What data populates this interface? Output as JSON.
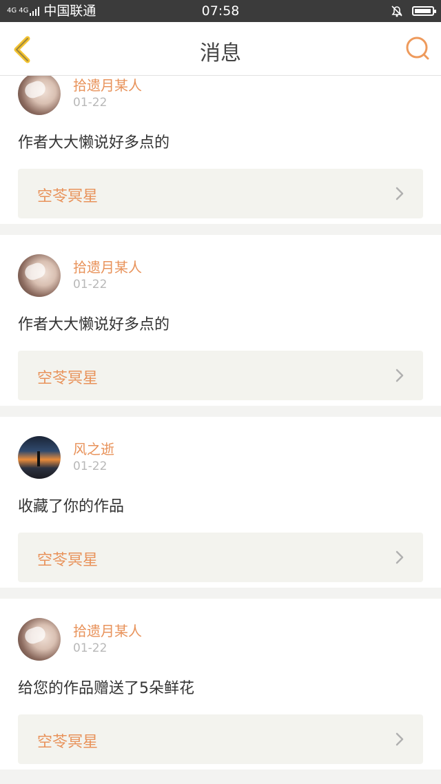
{
  "status_bar": {
    "network": "4G 4G",
    "carrier": "中国联通",
    "time": "07:58",
    "battery_level": 0.95
  },
  "nav": {
    "back_icon": "chevron-left-icon",
    "title": "消息",
    "search_icon": "search-icon",
    "accent_color": "#e8925a"
  },
  "messages": [
    {
      "username": "拾遗月某人",
      "date": "01-22",
      "content": "作者大大懒说好多点的",
      "work_title": "空苓冥星",
      "avatar": "girl-avatar"
    },
    {
      "username": "拾遗月某人",
      "date": "01-22",
      "content": "作者大大懒说好多点的",
      "work_title": "空苓冥星",
      "avatar": "girl-avatar"
    },
    {
      "username": "风之逝",
      "date": "01-22",
      "content": "收藏了你的作品",
      "work_title": "空苓冥星",
      "avatar": "sunset-avatar"
    },
    {
      "username": "拾遗月某人",
      "date": "01-22",
      "content": "给您的作品赠送了5朵鲜花",
      "work_title": "空苓冥星",
      "avatar": "girl-avatar"
    }
  ]
}
